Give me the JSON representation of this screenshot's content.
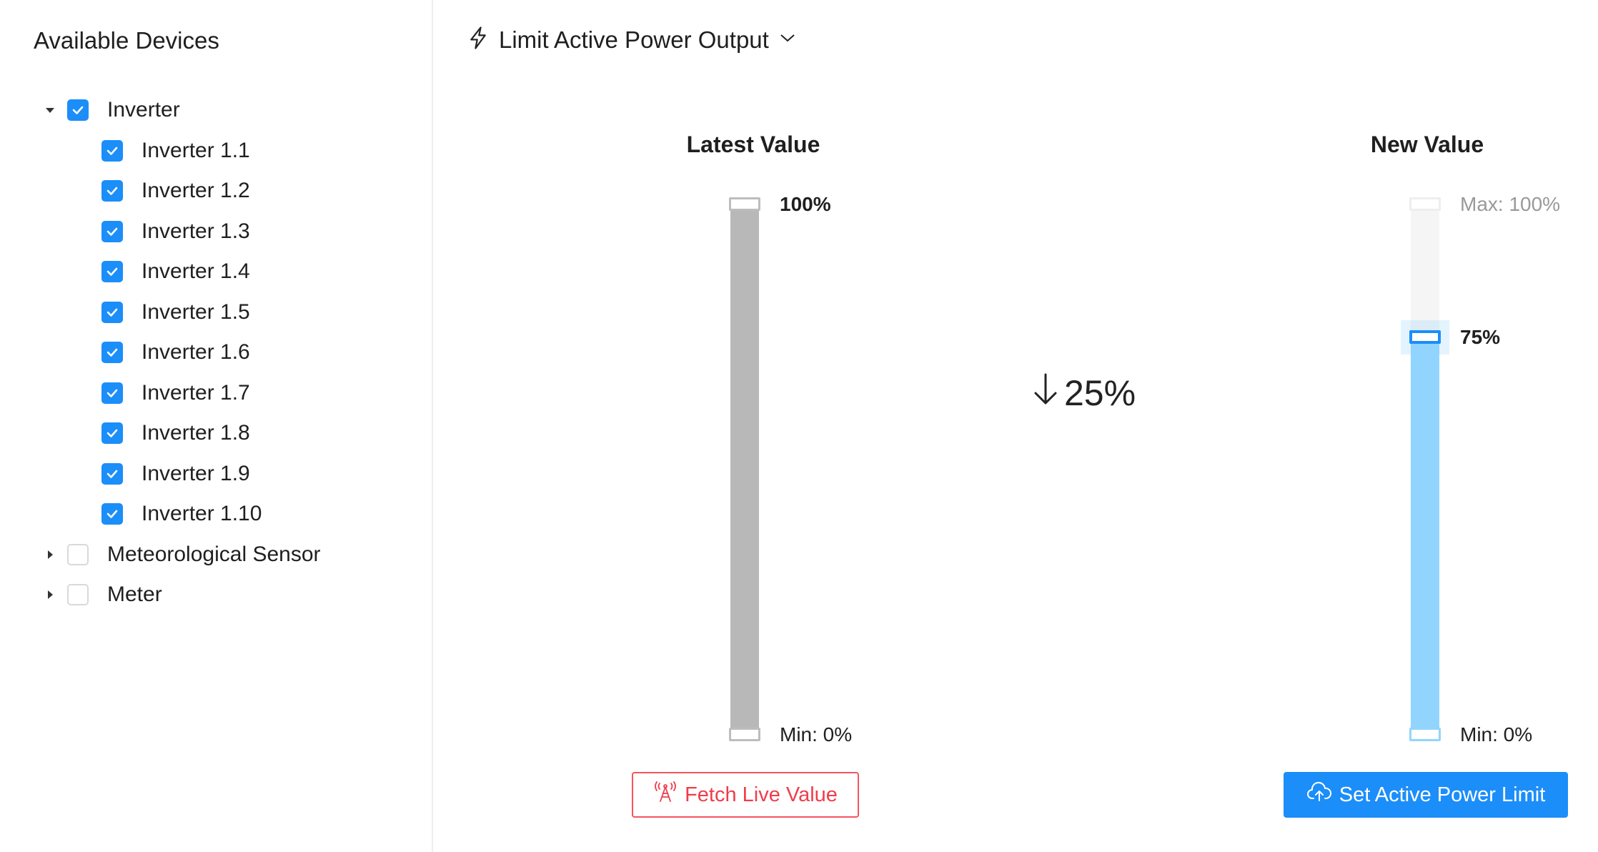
{
  "sidebar": {
    "title": "Available Devices",
    "tree": [
      {
        "label": "Inverter",
        "checked": true,
        "expanded": true,
        "level": 0
      },
      {
        "label": "Inverter 1.1",
        "checked": true,
        "level": 1
      },
      {
        "label": "Inverter 1.2",
        "checked": true,
        "level": 1
      },
      {
        "label": "Inverter 1.3",
        "checked": true,
        "level": 1
      },
      {
        "label": "Inverter 1.4",
        "checked": true,
        "level": 1
      },
      {
        "label": "Inverter 1.5",
        "checked": true,
        "level": 1
      },
      {
        "label": "Inverter 1.6",
        "checked": true,
        "level": 1
      },
      {
        "label": "Inverter 1.7",
        "checked": true,
        "level": 1
      },
      {
        "label": "Inverter 1.8",
        "checked": true,
        "level": 1
      },
      {
        "label": "Inverter 1.9",
        "checked": true,
        "level": 1
      },
      {
        "label": "Inverter 1.10",
        "checked": true,
        "level": 1
      },
      {
        "label": "Meteorological Sensor",
        "checked": false,
        "expanded": false,
        "level": 0
      },
      {
        "label": "Meter",
        "checked": false,
        "expanded": false,
        "level": 0
      }
    ]
  },
  "header": {
    "title": "Limit Active Power Output",
    "icon": "lightning-bolt-icon",
    "dropdown_icon": "chevron-down-icon"
  },
  "latest": {
    "title": "Latest Value",
    "value_label": "100%",
    "value_fraction": 1.0,
    "min_label": "Min: 0%",
    "bar_color": "#b8b8b8"
  },
  "delta": {
    "icon": "arrow-down-icon",
    "text": "25%"
  },
  "new_value": {
    "title": "New Value",
    "max_label": "Max: 100%",
    "value_label": "75%",
    "value_fraction": 0.75,
    "min_label": "Min: 0%",
    "fill_color": "#91d5ff",
    "track_color": "#f5f5f5"
  },
  "buttons": {
    "fetch_label": "Fetch Live Value",
    "fetch_icon": "broadcast-tower-icon",
    "set_label": "Set Active Power Limit",
    "set_icon": "cloud-upload-icon"
  },
  "colors": {
    "primary": "#1b8ef9",
    "danger": "#ef3d4b"
  }
}
